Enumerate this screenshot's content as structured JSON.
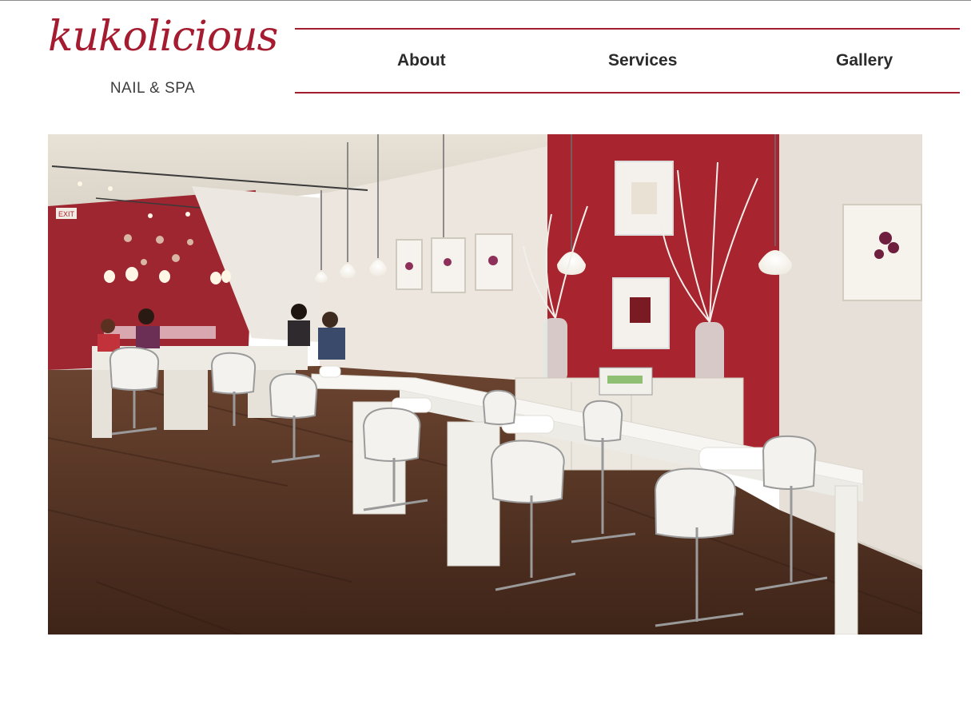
{
  "logo": {
    "script_text": "kukolicious",
    "subtitle": "NAIL & SPA"
  },
  "nav": {
    "items": [
      {
        "label": "About"
      },
      {
        "label": "Services"
      },
      {
        "label": "Gallery"
      }
    ]
  },
  "hero": {
    "exit_sign": "EXIT"
  },
  "colors": {
    "brand_red": "#a51c30",
    "accent_wall": "#a8242e",
    "floor": "#4a2c1e"
  }
}
